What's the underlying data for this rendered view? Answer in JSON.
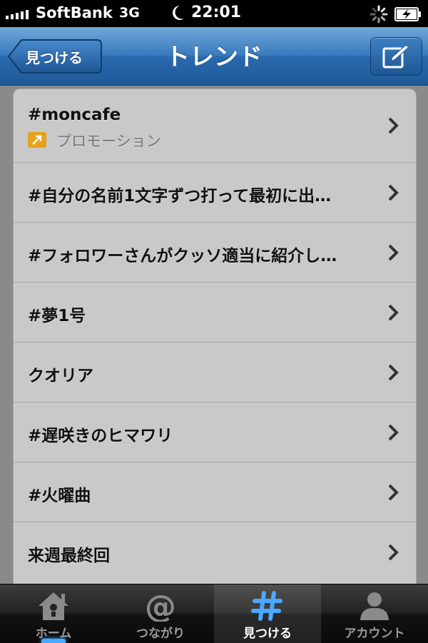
{
  "status_bar": {
    "carrier": "SoftBank",
    "network": "3G",
    "time": "22:01"
  },
  "nav": {
    "back_label": "見つける",
    "title": "トレンド",
    "compose_icon": "compose-icon"
  },
  "trends": [
    {
      "title": "#moncafe",
      "promoted_label": "プロモーション"
    },
    {
      "title": "#自分の名前1文字ずつ打って最初に出…"
    },
    {
      "title": "#フォロワーさんがクッソ適当に紹介し…"
    },
    {
      "title": "#夢1号"
    },
    {
      "title": "クオリア"
    },
    {
      "title": "#遅咲きのヒマワリ"
    },
    {
      "title": "#火曜曲"
    },
    {
      "title": "来週最終回"
    }
  ],
  "tabs": [
    {
      "label": "ホーム",
      "icon": "home-icon"
    },
    {
      "label": "つながり",
      "icon": "at-icon"
    },
    {
      "label": "見つける",
      "icon": "hash-icon",
      "active": true
    },
    {
      "label": "アカウント",
      "icon": "person-icon"
    }
  ],
  "colors": {
    "nav_blue": "#2a69ad",
    "list_bg": "#c9c9c9",
    "promo_orange": "#e8a21a",
    "active_tab_icon": "#4aa8ff"
  }
}
